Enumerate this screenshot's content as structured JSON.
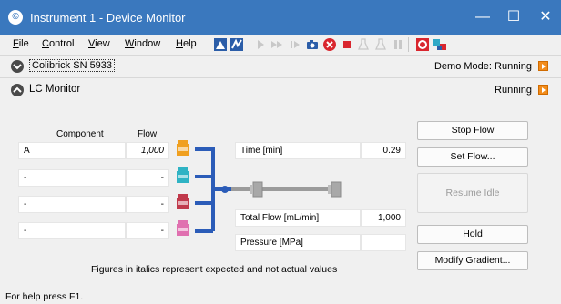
{
  "window": {
    "title": "Instrument 1 - Device Monitor",
    "title_bar_color": "#3a78be",
    "controls": [
      "minimize-icon",
      "maximize-icon",
      "close-icon"
    ]
  },
  "menu": {
    "items": [
      {
        "label": "File",
        "key": "F"
      },
      {
        "label": "Control",
        "key": "C"
      },
      {
        "label": "View",
        "key": "V"
      },
      {
        "label": "Window",
        "key": "W"
      },
      {
        "label": "Help",
        "key": "H"
      }
    ],
    "toolbar_icons": [
      "audit-icon",
      "sequence-icon",
      "play-icon",
      "fast-forward-icon",
      "step-icon",
      "camera-icon",
      "abort-icon",
      "stop-icon",
      "flask-icon",
      "flask-alt-icon",
      "pause-icon",
      "snapshot-icon",
      "network-icon"
    ]
  },
  "device": {
    "name": "Colibrick SN 5933",
    "status": "Demo Mode: Running"
  },
  "lc_monitor": {
    "title": "LC Monitor",
    "status": "Running"
  },
  "table": {
    "col_component": "Component",
    "col_flow": "Flow",
    "rows": [
      {
        "component": "A",
        "flow": "1,000",
        "bottle_color": "#f0a020"
      },
      {
        "component": "-",
        "flow": "-",
        "bottle_color": "#2fb3c4"
      },
      {
        "component": "-",
        "flow": "-",
        "bottle_color": "#c0394b"
      },
      {
        "component": "-",
        "flow": "-",
        "bottle_color": "#e070b0"
      }
    ]
  },
  "readouts": {
    "time_label": "Time [min]",
    "time_value": "0.29",
    "total_flow_label": "Total Flow [mL/min]",
    "total_flow_value": "1,000",
    "pressure_label": "Pressure [MPa]",
    "pressure_value": ""
  },
  "buttons": {
    "stop_flow": "Stop Flow",
    "set_flow": "Set Flow...",
    "resume_idle": "Resume Idle",
    "hold": "Hold",
    "modify_gradient": "Modify Gradient..."
  },
  "note": "Figures in italics represent expected and not actual values",
  "status_bar": "For help press F1."
}
